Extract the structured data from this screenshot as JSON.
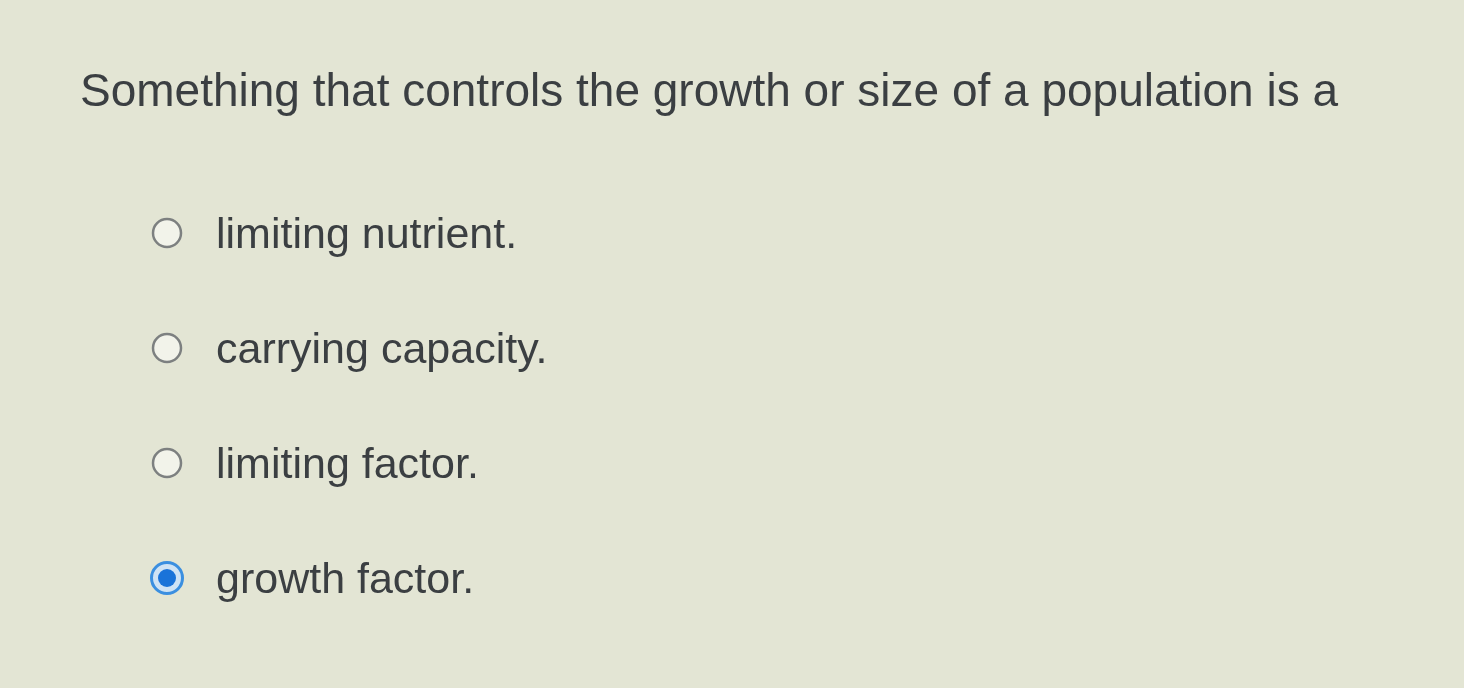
{
  "question": {
    "text": "Something that controls the growth or size of a population is a"
  },
  "options": [
    {
      "label": "limiting nutrient.",
      "selected": false
    },
    {
      "label": "carrying capacity.",
      "selected": false
    },
    {
      "label": "limiting factor.",
      "selected": false
    },
    {
      "label": "growth factor.",
      "selected": true
    }
  ]
}
